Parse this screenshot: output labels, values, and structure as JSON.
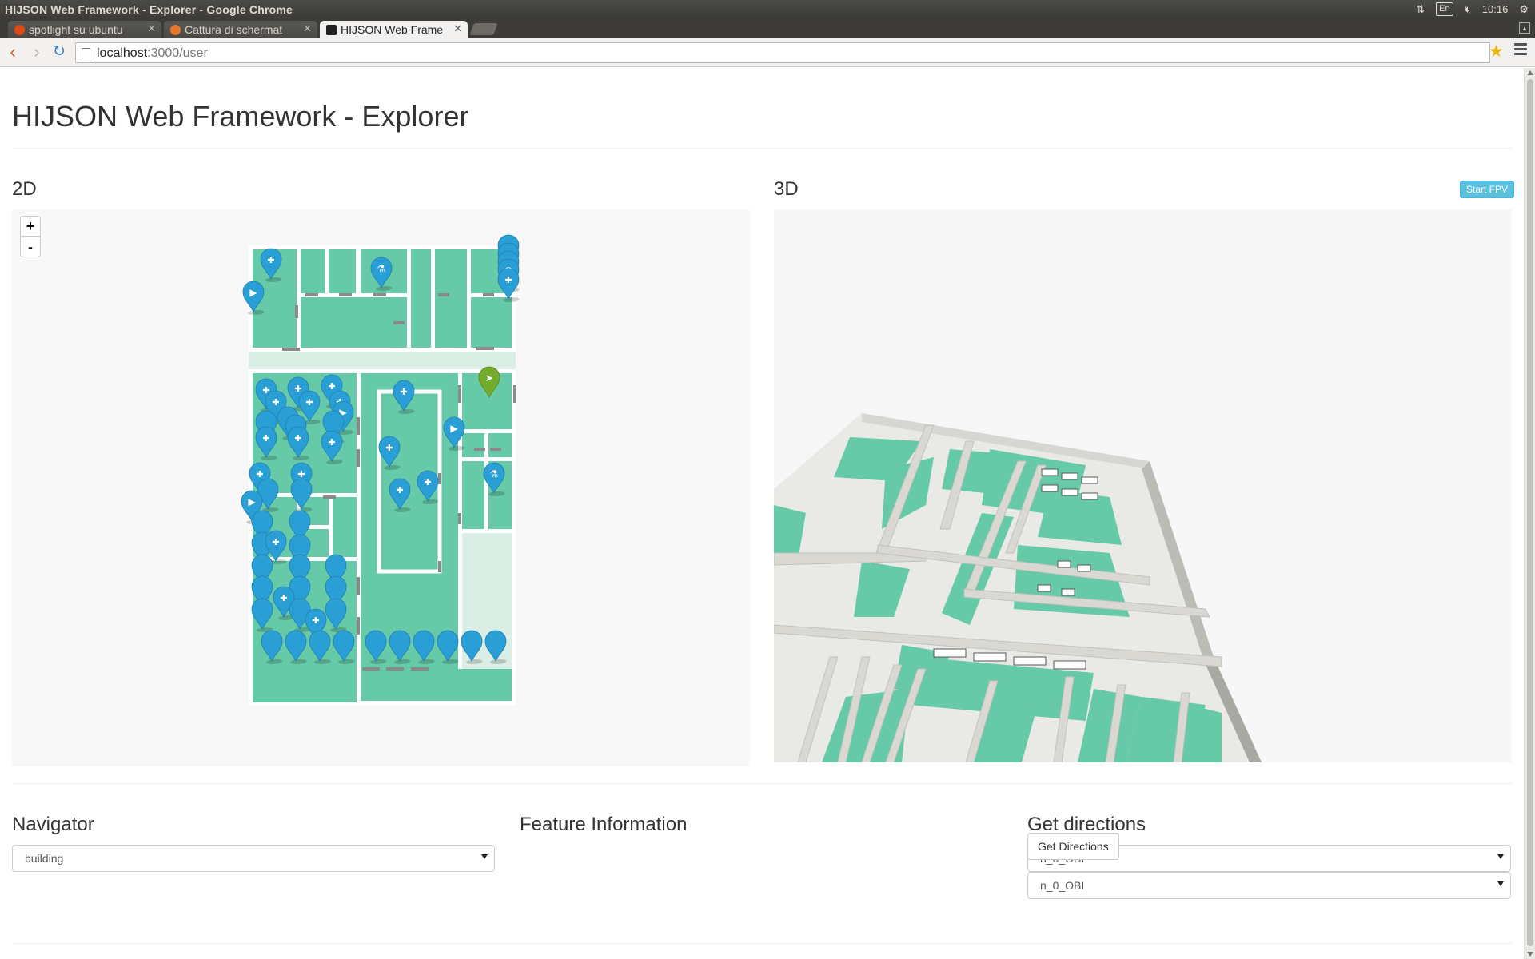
{
  "window": {
    "title": "HIJSON Web Framework - Explorer - Google Chrome",
    "clock": "10:16",
    "keyboard": "En"
  },
  "tabs": [
    {
      "label": "spotlight su ubuntu",
      "active": false
    },
    {
      "label": "Cattura di schermat",
      "active": false
    },
    {
      "label": "HIJSON Web Frame",
      "active": true
    }
  ],
  "address": {
    "host": "localhost",
    "path": ":3000/user"
  },
  "page": {
    "title": "HIJSON Web Framework - Explorer",
    "panel_2d": {
      "heading": "2D",
      "zoom_in": "+",
      "zoom_out": "-"
    },
    "panel_3d": {
      "heading": "3D",
      "fpv_button": "Start FPV"
    },
    "navigator": {
      "heading": "Navigator",
      "selected": "building"
    },
    "feature_info": {
      "heading": "Feature Information"
    },
    "directions": {
      "heading": "Get directions",
      "from_selected": "n_0_OBI",
      "to_selected": "n_0_OBI",
      "button": "Get Directions"
    }
  },
  "colors": {
    "room_fill": "#66c9a8",
    "corridor_fill": "#dbeee6",
    "marker_blue": "#2a9fd6",
    "marker_green": "#73ab2c",
    "fpv_button": "#5bc0de"
  },
  "markers_2d": {
    "icon_types": [
      "hospital-icon",
      "camera-icon",
      "lab-icon",
      "navigation-icon",
      "wifi-icon"
    ],
    "counts": {
      "hospital": 26,
      "camera": 5,
      "lab": 2,
      "navigation": 1,
      "wifi": 4,
      "plain": 34
    }
  }
}
